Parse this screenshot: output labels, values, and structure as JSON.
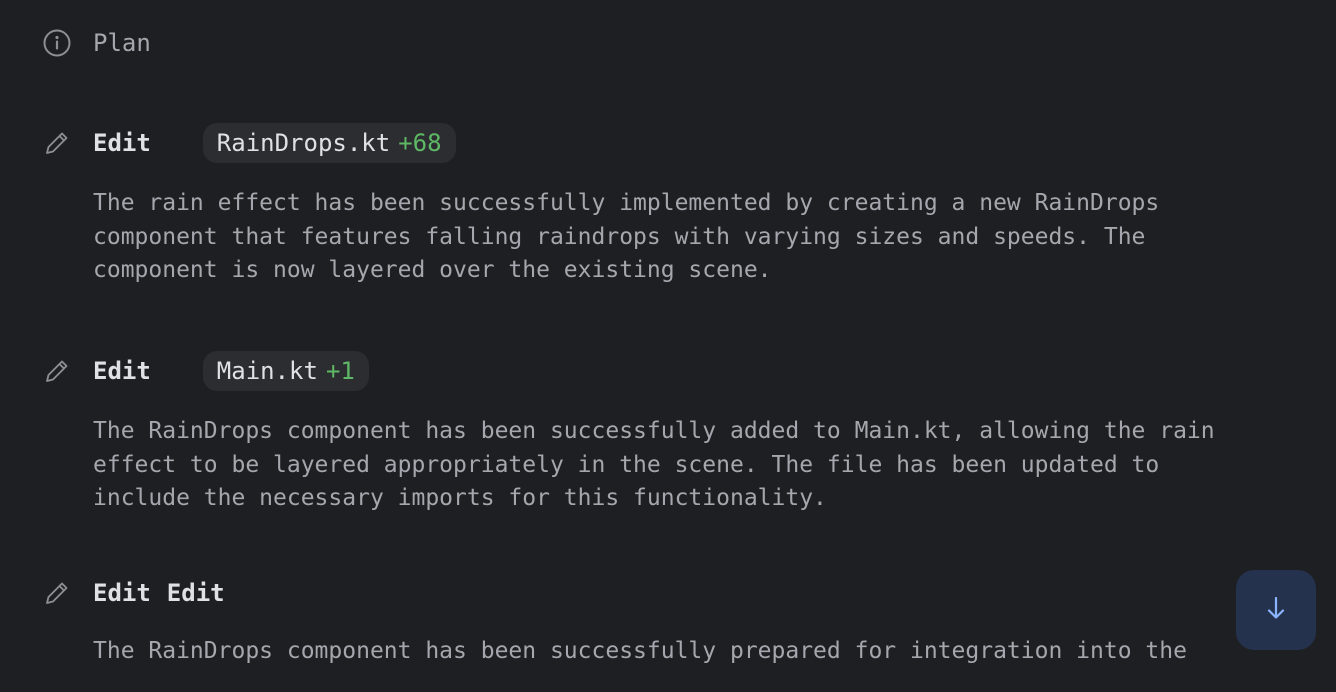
{
  "plan": {
    "label": "Plan",
    "icon": "info-icon"
  },
  "entries": [
    {
      "action": "Edit",
      "icon": "pencil-icon",
      "file": "RainDrops.kt",
      "delta": "+68",
      "description": "The rain effect has been successfully implemented by creating a new RainDrops\ncomponent that features falling raindrops with varying sizes and speeds. The\ncomponent is now layered over the existing scene."
    },
    {
      "action": "Edit",
      "icon": "pencil-icon",
      "file": "Main.kt",
      "delta": "+1",
      "description": "The RainDrops component has been successfully added to Main.kt, allowing the rain\neffect to be layered appropriately in the scene. The file has been updated to\ninclude the necessary imports for this functionality."
    },
    {
      "action": "Edit",
      "action2": "Edit",
      "icon": "pencil-icon",
      "description": "The RainDrops component has been successfully prepared for integration into the"
    }
  ],
  "scroll_button": {
    "icon": "arrow-down-icon"
  },
  "colors": {
    "background": "#1e1f22",
    "chip_bg": "#2b2d30",
    "added": "#5fb865",
    "scroll_bg": "#25324d",
    "scroll_arrow": "#8ab4ff"
  }
}
